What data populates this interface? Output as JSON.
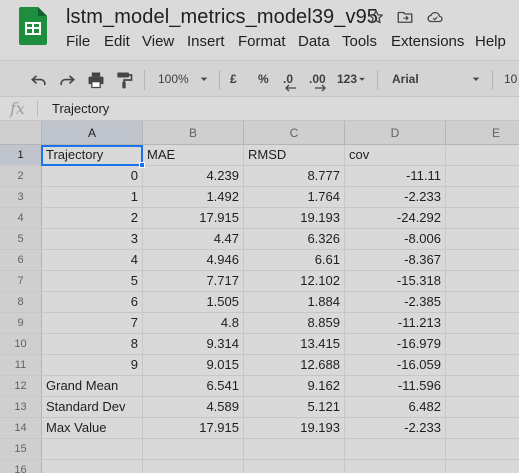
{
  "app": {
    "title": "lstm_model_metrics_model39_v95",
    "icons": {
      "logo": "sheets-logo",
      "star": "star-icon",
      "move": "move-to-folder-icon",
      "cloud": "cloud-status-icon"
    }
  },
  "menu": [
    "File",
    "Edit",
    "View",
    "Insert",
    "Format",
    "Data",
    "Tools",
    "Extensions",
    "Help"
  ],
  "toolbar": {
    "zoom": "100%",
    "currency": "£",
    "percent": "%",
    "decrease_decimals": ".0",
    "increase_decimals": ".00",
    "more_formats": "123",
    "font": "Arial",
    "font_size": "10"
  },
  "formula_bar": {
    "fx_label": "fx",
    "value": "Trajectory"
  },
  "grid": {
    "columns": [
      "A",
      "B",
      "C",
      "D",
      "E"
    ],
    "row_numbers": [
      "1",
      "2",
      "3",
      "4",
      "5",
      "6",
      "7",
      "8",
      "9",
      "10",
      "11",
      "12",
      "13",
      "14",
      "15",
      "16"
    ],
    "rows": [
      [
        "Trajectory",
        "MAE",
        "RMSD",
        "cov"
      ],
      [
        "0",
        "4.239",
        "8.777",
        "-11.11"
      ],
      [
        "1",
        "1.492",
        "1.764",
        "-2.233"
      ],
      [
        "2",
        "17.915",
        "19.193",
        "-24.292"
      ],
      [
        "3",
        "4.47",
        "6.326",
        "-8.006"
      ],
      [
        "4",
        "4.946",
        "6.61",
        "-8.367"
      ],
      [
        "5",
        "7.717",
        "12.102",
        "-15.318"
      ],
      [
        "6",
        "1.505",
        "1.884",
        "-2.385"
      ],
      [
        "7",
        "4.8",
        "8.859",
        "-11.213"
      ],
      [
        "8",
        "9.314",
        "13.415",
        "-16.979"
      ],
      [
        "9",
        "9.015",
        "12.688",
        "-16.059"
      ],
      [
        "Grand Mean",
        "6.541",
        "9.162",
        "-11.596"
      ],
      [
        "Standard Dev",
        "4.589",
        "5.121",
        "6.482"
      ],
      [
        "Max Value",
        "17.915",
        "19.193",
        "-2.233"
      ],
      [
        "",
        "",
        "",
        ""
      ],
      [
        "",
        "",
        "",
        ""
      ]
    ],
    "selected_cell": "A1"
  },
  "colors": {
    "accent": "#1a73e8",
    "sheets_green": "#188038"
  }
}
